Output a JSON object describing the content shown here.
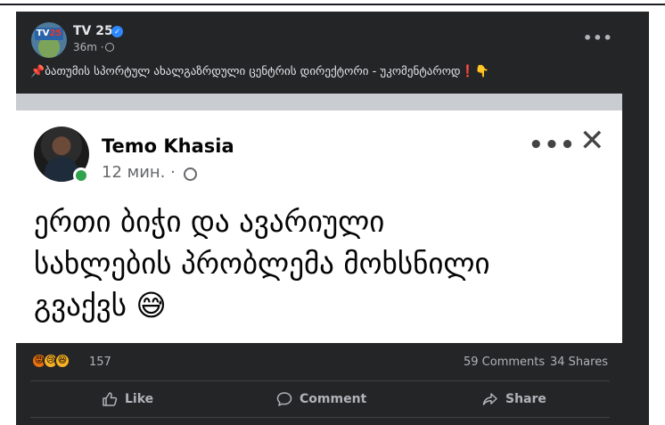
{
  "post": {
    "page_name": "TV 25",
    "avatar_logo": {
      "left": "TV",
      "right": "25"
    },
    "time": "36m ·",
    "more_icon": "•••",
    "text_pin": "📌",
    "text": "ბათუმის სპორტულ ახალგაზრდული ცენტრის დირექტორი - უკომენტაროდ",
    "text_end_emoji": "❗👇"
  },
  "shared_screenshot": {
    "author_name": "Temo Khasia",
    "time": "12 мин. ·",
    "more_icon": "•••",
    "close_icon": "✕",
    "text_lines": [
      "ერთი ბიჭი და ავარიული",
      "სახლების პრობლემა მოხსნილი",
      "გვაქვს 😅"
    ]
  },
  "stats": {
    "reaction_icons": [
      "angry-icon",
      "sad-icon",
      "haha-icon"
    ],
    "reaction_glyphs": [
      "😡",
      "😢",
      "😆"
    ],
    "reactions_count": "157",
    "comments": "59 Comments",
    "shares": "34 Shares"
  },
  "actions": {
    "like": "Like",
    "comment": "Comment",
    "share": "Share"
  },
  "colors": {
    "card_bg": "#242526",
    "text_primary": "#e4e6eb",
    "text_secondary": "#b0b3b8",
    "verified": "#2d88ff",
    "online": "#31a24c"
  }
}
